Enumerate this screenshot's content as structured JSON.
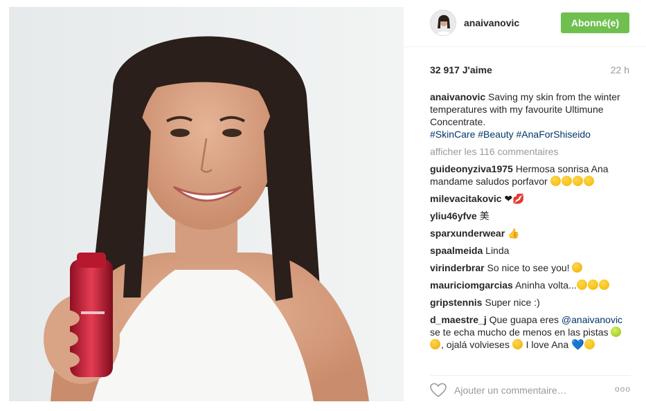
{
  "post": {
    "username": "anaivanovic",
    "follow_label": "Abonné(e)",
    "likes": "32 917 J'aime",
    "timestamp": "22 h",
    "caption": {
      "user": "anaivanovic",
      "text": "Saving my skin from the winter temperatures with my favourite Ultimune Concentrate.",
      "tags": "#SkinCare #Beauty #AnaForShiseido"
    },
    "view_all_comments": "afficher les 116 commentaires",
    "comments": [
      {
        "user": "guideonyziva1975",
        "text": "Hermosa sonrisa Ana mandame saludos porfavor"
      },
      {
        "user": "milevacitakovic",
        "text": ""
      },
      {
        "user": "yliu46yfve",
        "text": "美"
      },
      {
        "user": "sparxunderwear",
        "text": ""
      },
      {
        "user": "spaalmeida",
        "text": "Linda"
      },
      {
        "user": "virinderbrar",
        "text": "So nice to see you!"
      },
      {
        "user": "mauriciomgarcias",
        "text": "Aninha volta..."
      },
      {
        "user": "gripstennis",
        "text": "Super nice :)"
      },
      {
        "user": "d_maestre_j",
        "text_before": "Que guapa eres",
        "mention": "@anaivanovic",
        "text_after": "se te echa mucho de menos en las pistas",
        "text_mid": ", ojalá volvieses",
        "text_end": "I love Ana"
      }
    ],
    "comment_placeholder": "Ajouter un commentaire…",
    "more_label": "ooo"
  },
  "icons": {
    "like": "heart-outline-icon",
    "more": "ellipsis-icon"
  },
  "colors": {
    "follow_button": "#70c050",
    "link": "#003569",
    "muted": "#999999"
  }
}
